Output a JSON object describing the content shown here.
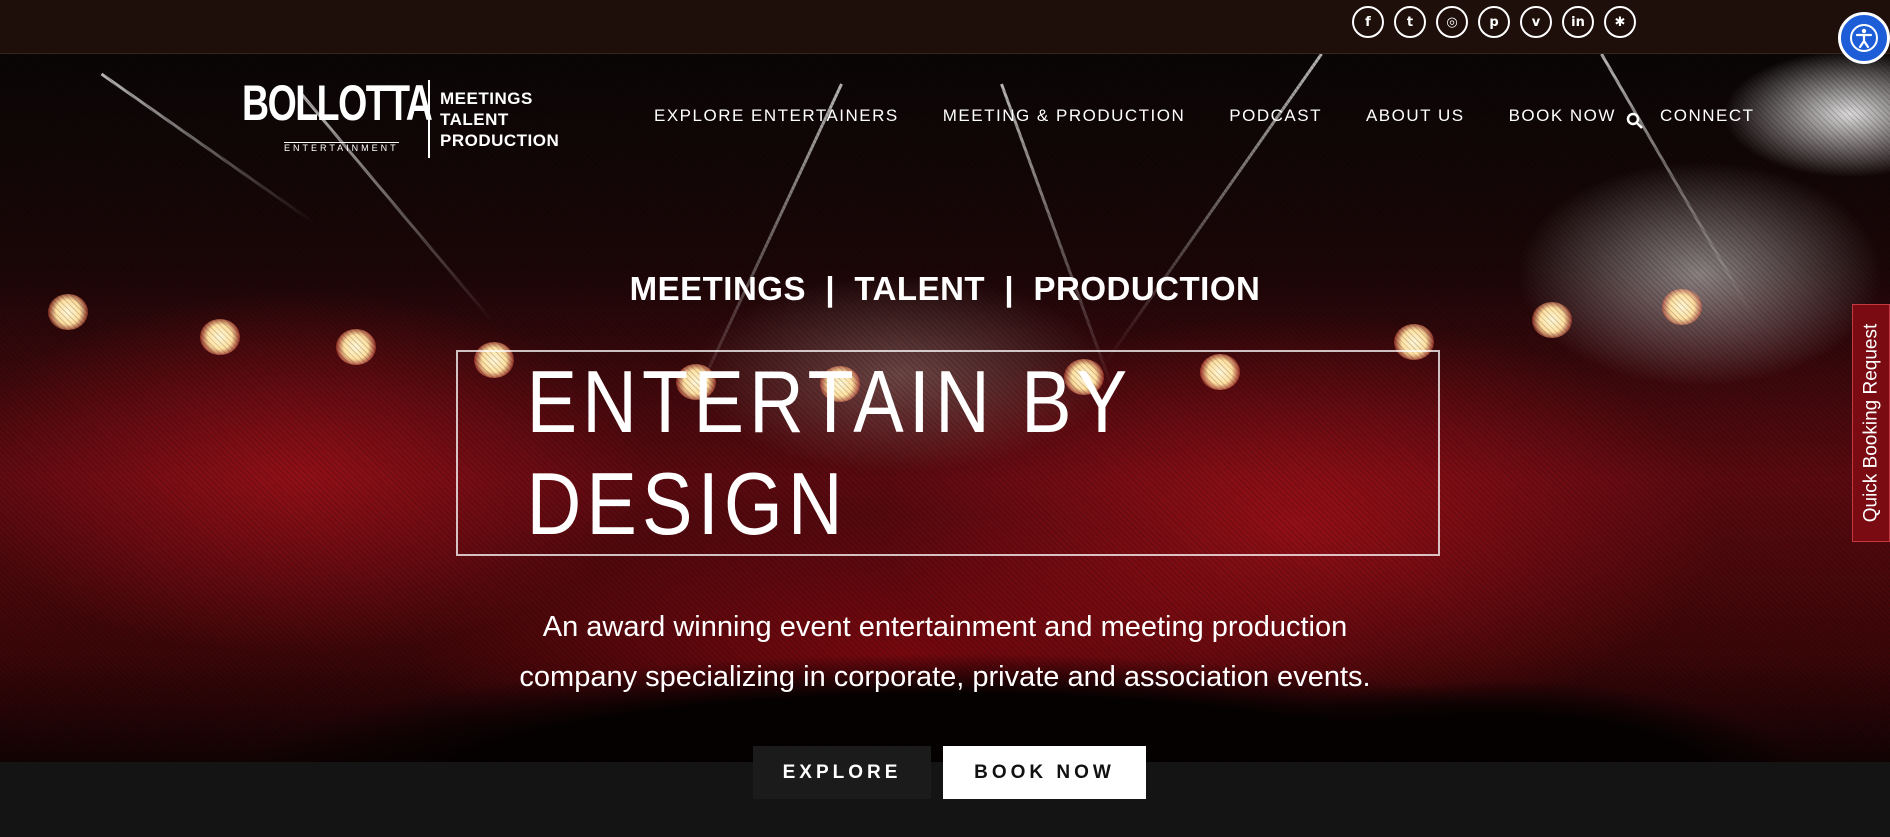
{
  "social": [
    {
      "icon": "facebook-icon",
      "glyph": "f"
    },
    {
      "icon": "twitter-icon",
      "glyph": "t"
    },
    {
      "icon": "instagram-icon",
      "glyph": "◎"
    },
    {
      "icon": "pinterest-icon",
      "glyph": "p"
    },
    {
      "icon": "vimeo-icon",
      "glyph": "v"
    },
    {
      "icon": "linkedin-icon",
      "glyph": "in"
    },
    {
      "icon": "yelp-icon",
      "glyph": "✱"
    }
  ],
  "accessibility": {
    "icon": "accessibility-icon"
  },
  "logo": {
    "brand": "BOLLOTTA",
    "sub": "ENTERTAINMENT",
    "tagline": [
      "MEETINGS",
      "TALENT",
      "PRODUCTION"
    ]
  },
  "nav": {
    "items": [
      "EXPLORE ENTERTAINERS",
      "MEETING & PRODUCTION",
      "PODCAST",
      "ABOUT US",
      "BOOK NOW",
      "CONNECT"
    ],
    "search_icon": "search-icon"
  },
  "hero": {
    "kicker": "MEETINGS  |  TALENT  |  PRODUCTION",
    "headline": "ENTERTAIN BY DESIGN",
    "description_line1": "An award winning event entertainment and meeting production",
    "description_line2": "company specializing in corporate, private and association events."
  },
  "cta": {
    "explore": "EXPLORE",
    "book": "BOOK NOW"
  },
  "side_tab": {
    "label": "Quick Booking Request"
  },
  "colors": {
    "topbar": "#1e0f0b",
    "accent_red": "#7a0b12",
    "accessibility_blue": "#1d5ed8"
  }
}
